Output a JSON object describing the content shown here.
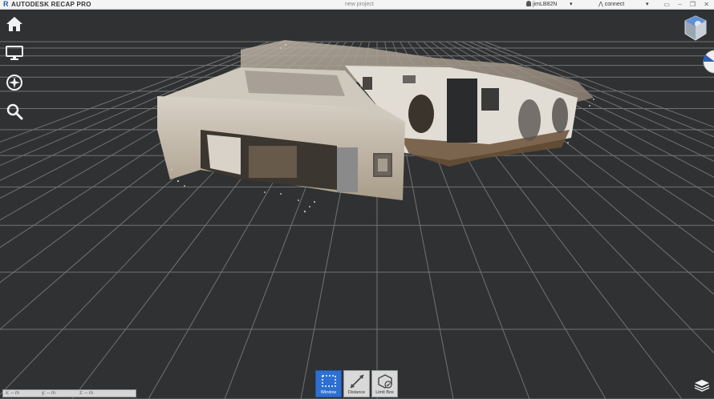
{
  "titlebar": {
    "app_title": "AUTODESK RECAP PRO",
    "doc_title": "new project",
    "user": "jimLB82N",
    "connect": "connect",
    "caret": "▾"
  },
  "left_toolbar": [
    {
      "name": "home-icon"
    },
    {
      "name": "monitor-icon"
    },
    {
      "name": "compass-icon"
    },
    {
      "name": "search-icon"
    }
  ],
  "bottom_toolbar": [
    {
      "label": "Window",
      "icon": "window-select-icon",
      "active": true
    },
    {
      "label": "Distance",
      "icon": "distance-icon",
      "active": false
    },
    {
      "label": "Limit Box",
      "icon": "limit-box-icon",
      "active": false
    }
  ],
  "coords": {
    "x": "x: -- m",
    "y": "y: -- m",
    "z": "z: -- m"
  },
  "colors": {
    "background": "#2f3132",
    "grid": "#8a8c8e",
    "active_tool": "#2e6fd1"
  }
}
